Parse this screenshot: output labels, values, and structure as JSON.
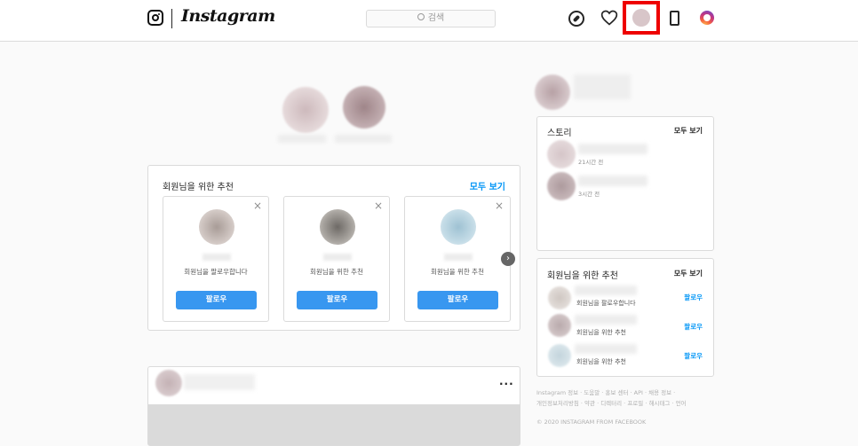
{
  "app": {
    "brand": "Instagram"
  },
  "header": {
    "search_placeholder": "검색",
    "icons": [
      "instagram-glyph-icon",
      "compass-icon",
      "heart-icon",
      "profile-avatar",
      "phone-icon",
      "instagram-color-icon"
    ],
    "highlight_color": "#ee0000"
  },
  "suggestions": {
    "title": "회원님을 위한 추천",
    "see_all": "모두 보기",
    "cards": [
      {
        "subtitle": "회원님을 팔로우합니다",
        "button": "팔로우"
      },
      {
        "subtitle": "회원님을 위한 추천",
        "button": "팔로우"
      },
      {
        "subtitle": "회원님을 위한 추천",
        "button": "팔로우"
      }
    ]
  },
  "post": {
    "more": "···"
  },
  "sidebar": {
    "stories": {
      "title": "스토리",
      "see_all": "모두 보기",
      "items": [
        {
          "time": "21시간 전"
        },
        {
          "time": "3시간 전"
        }
      ]
    },
    "recommend": {
      "title": "회원님을 위한 추천",
      "see_all": "모두 보기",
      "items": [
        {
          "sub": "회원님을 팔로우합니다",
          "action": "팔로우"
        },
        {
          "sub": "회원님을 위한 추천",
          "action": "팔로우"
        },
        {
          "sub": "회원님을 위한 추천",
          "action": "팔로우"
        }
      ]
    },
    "footer_line1": "Instagram 정보 · 도움말 · 홍보 센터 · API · 채용 정보 ·",
    "footer_line2": "개인정보처리방침 · 약관 · 디렉터리 · 프로필 · 해시태그 · 언어",
    "copyright": "© 2020 INSTAGRAM FROM FACEBOOK"
  },
  "colors": {
    "accent": "#0095f6",
    "button": "#3897f0",
    "border": "#dbdbdb",
    "background": "#fafafa"
  }
}
